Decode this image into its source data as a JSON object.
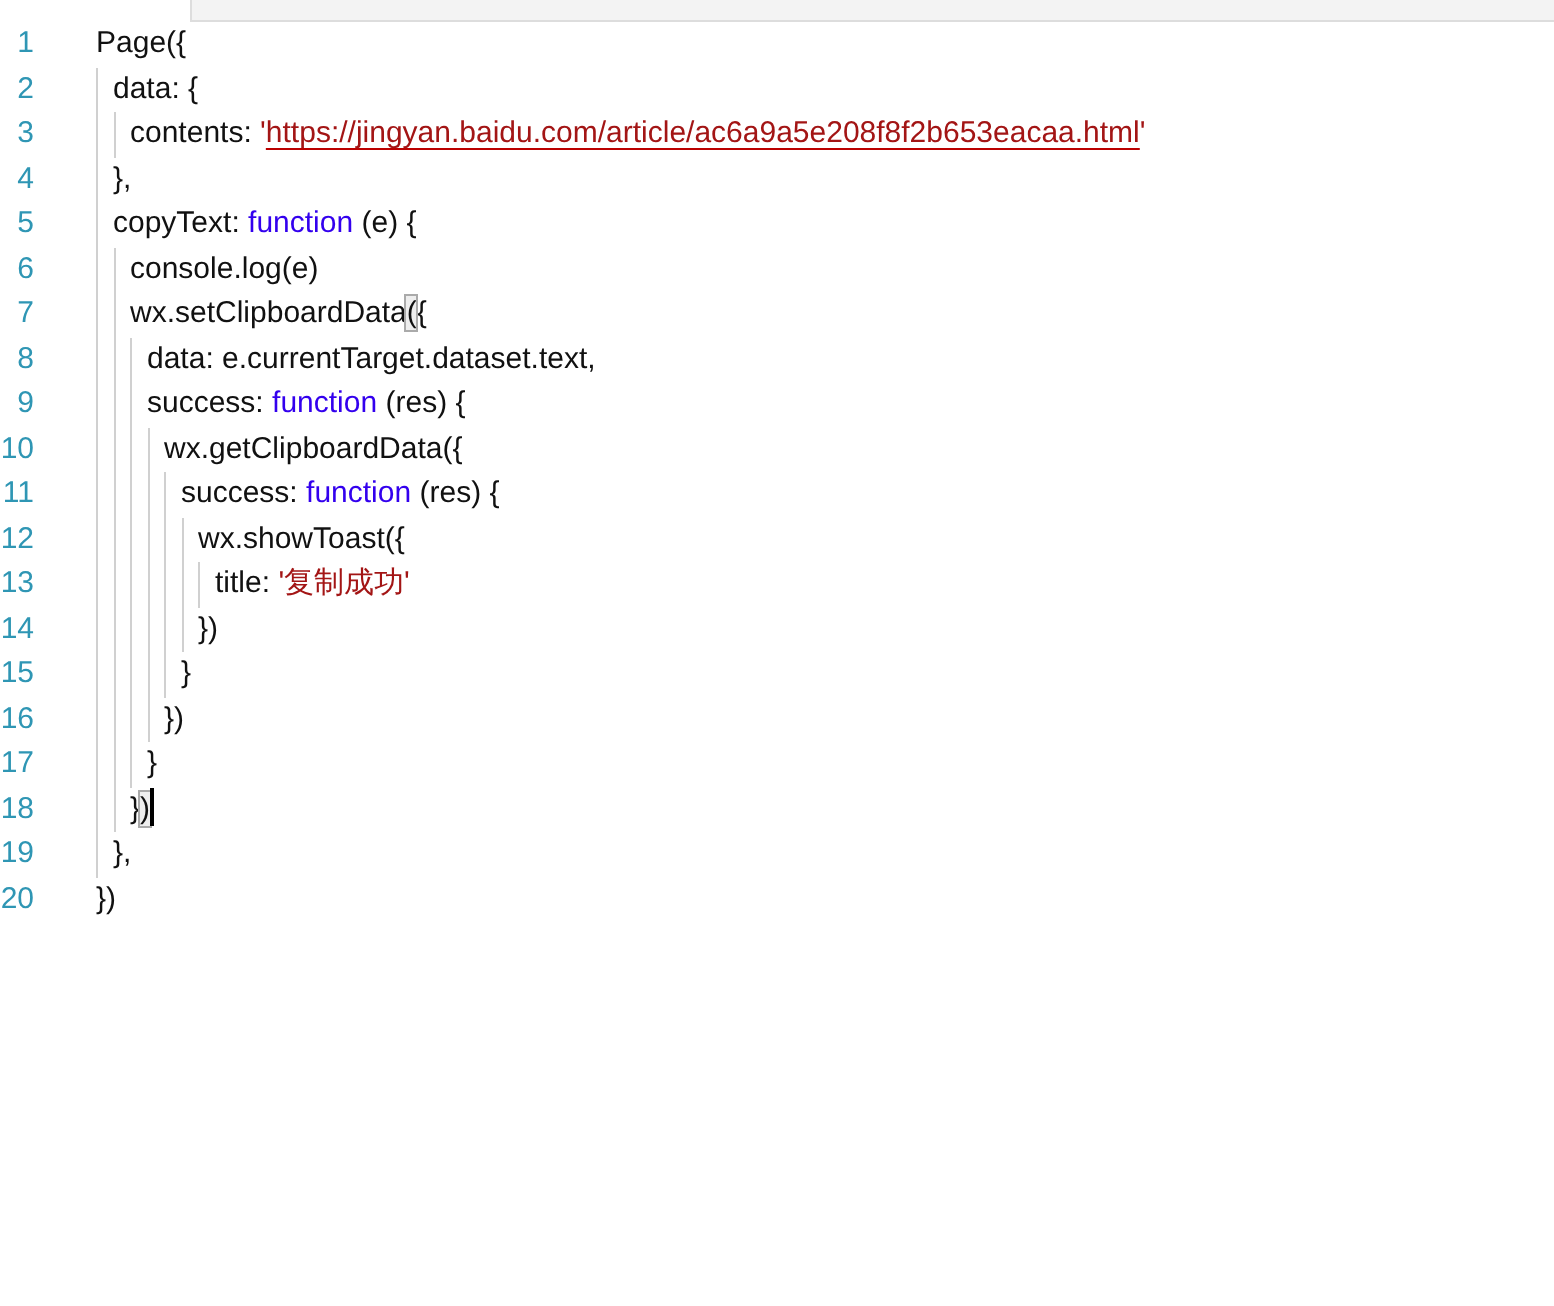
{
  "tabs": [
    {
      "selected": true
    },
    {
      "selected": false
    }
  ],
  "code": [
    {
      "number": "1",
      "tokens": [
        {
          "kind": "plain",
          "text": "Page({"
        }
      ],
      "children": [
        {
          "number": "2",
          "tokens": [
            {
              "kind": "plain",
              "text": "data: {"
            }
          ],
          "children": [
            {
              "number": "3",
              "tokens": [
                {
                  "kind": "plain",
                  "text": "contents: "
                },
                {
                  "kind": "string",
                  "text": "'"
                },
                {
                  "kind": "url",
                  "text": "https://jingyan.baidu.com/article/ac6a9a5e208f8f2b653eacaa.html"
                },
                {
                  "kind": "string",
                  "text": "'"
                }
              ]
            }
          ]
        },
        {
          "number": "4",
          "tokens": [
            {
              "kind": "plain",
              "text": "},"
            }
          ]
        },
        {
          "number": "5",
          "tokens": [
            {
              "kind": "plain",
              "text": "copyText: "
            },
            {
              "kind": "keyword",
              "text": "function"
            },
            {
              "kind": "plain",
              "text": " (e) {"
            }
          ],
          "children": [
            {
              "number": "6",
              "tokens": [
                {
                  "kind": "plain",
                  "text": "console.log(e)"
                }
              ]
            },
            {
              "number": "7",
              "tokens": [
                {
                  "kind": "plain",
                  "text": "wx.setClipboardData"
                },
                {
                  "kind": "match",
                  "text": "("
                },
                {
                  "kind": "plain",
                  "text": "{"
                }
              ],
              "children": [
                {
                  "number": "8",
                  "tokens": [
                    {
                      "kind": "plain",
                      "text": "data: e.currentTarget.dataset.text,"
                    }
                  ]
                },
                {
                  "number": "9",
                  "tokens": [
                    {
                      "kind": "plain",
                      "text": "success: "
                    },
                    {
                      "kind": "keyword",
                      "text": "function"
                    },
                    {
                      "kind": "plain",
                      "text": " (res) {"
                    }
                  ],
                  "children": [
                    {
                      "number": "10",
                      "tokens": [
                        {
                          "kind": "plain",
                          "text": "wx.getClipboardData({"
                        }
                      ],
                      "children": [
                        {
                          "number": "11",
                          "tokens": [
                            {
                              "kind": "plain",
                              "text": "success: "
                            },
                            {
                              "kind": "keyword",
                              "text": "function"
                            },
                            {
                              "kind": "plain",
                              "text": " (res) {"
                            }
                          ],
                          "children": [
                            {
                              "number": "12",
                              "tokens": [
                                {
                                  "kind": "plain",
                                  "text": "wx.showToast({"
                                }
                              ],
                              "children": [
                                {
                                  "number": "13",
                                  "tokens": [
                                    {
                                      "kind": "plain",
                                      "text": "title: "
                                    },
                                    {
                                      "kind": "string",
                                      "text": "'复制成功'"
                                    }
                                  ]
                                }
                              ]
                            },
                            {
                              "number": "14",
                              "tokens": [
                                {
                                  "kind": "plain",
                                  "text": "})"
                                }
                              ]
                            }
                          ]
                        },
                        {
                          "number": "15",
                          "tokens": [
                            {
                              "kind": "plain",
                              "text": "}"
                            }
                          ]
                        }
                      ]
                    },
                    {
                      "number": "16",
                      "tokens": [
                        {
                          "kind": "plain",
                          "text": "})"
                        }
                      ]
                    }
                  ]
                },
                {
                  "number": "17",
                  "tokens": [
                    {
                      "kind": "plain",
                      "text": "}"
                    }
                  ]
                }
              ]
            },
            {
              "number": "18",
              "cursor": true,
              "tokens": [
                {
                  "kind": "plain",
                  "text": "}"
                },
                {
                  "kind": "match",
                  "text": ")"
                }
              ]
            }
          ]
        },
        {
          "number": "19",
          "tokens": [
            {
              "kind": "plain",
              "text": "},"
            }
          ]
        }
      ]
    },
    {
      "number": "20",
      "tokens": [
        {
          "kind": "plain",
          "text": "})"
        }
      ]
    }
  ]
}
